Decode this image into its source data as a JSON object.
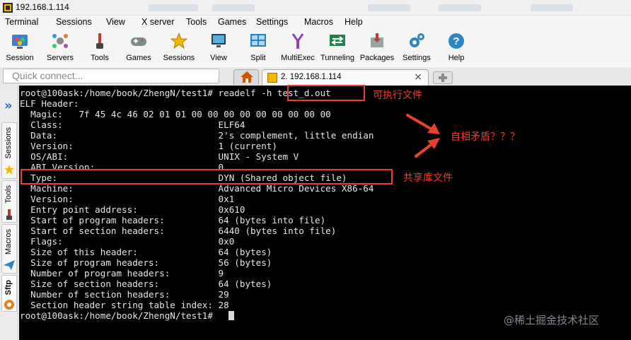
{
  "window": {
    "title": "192.168.1.114"
  },
  "menu": [
    "Terminal",
    "Sessions",
    "View",
    "X server",
    "Tools",
    "Games",
    "Settings",
    "Macros",
    "Help"
  ],
  "toolbar": [
    {
      "label": "Session",
      "icon": "session-icon"
    },
    {
      "label": "Servers",
      "icon": "servers-icon"
    },
    {
      "label": "Tools",
      "icon": "tools-icon"
    },
    {
      "label": "Games",
      "icon": "games-icon"
    },
    {
      "label": "Sessions",
      "icon": "star-icon"
    },
    {
      "label": "View",
      "icon": "view-icon"
    },
    {
      "label": "Split",
      "icon": "split-icon"
    },
    {
      "label": "MultiExec",
      "icon": "multiexec-icon"
    },
    {
      "label": "Tunneling",
      "icon": "tunneling-icon"
    },
    {
      "label": "Packages",
      "icon": "packages-icon"
    },
    {
      "label": "Settings",
      "icon": "gear-icon"
    },
    {
      "label": "Help",
      "icon": "help-icon"
    }
  ],
  "quick_connect": {
    "placeholder": "Quick connect..."
  },
  "tabs": {
    "session_label": "2. 192.168.1.114",
    "close_glyph": "×"
  },
  "side_tabs": [
    "Sessions",
    "Tools",
    "Macros",
    "Sftp"
  ],
  "terminal": {
    "lines": [
      "root@100ask:/home/book/ZhengN/test1# readelf -h test_d.out",
      "ELF Header:",
      "  Magic:   7f 45 4c 46 02 01 01 00 00 00 00 00 00 00 00 00",
      "  Class:                             ELF64",
      "  Data:                              2's complement, little endian",
      "  Version:                           1 (current)",
      "  OS/ABI:                            UNIX - System V",
      "  ABI Version:                       0",
      "  Type:                              DYN (Shared object file)",
      "  Machine:                           Advanced Micro Devices X86-64",
      "  Version:                           0x1",
      "  Entry point address:               0x610",
      "  Start of program headers:          64 (bytes into file)",
      "  Start of section headers:          6440 (bytes into file)",
      "  Flags:                             0x0",
      "  Size of this header:               64 (bytes)",
      "  Size of program headers:           56 (bytes)",
      "  Number of program headers:         9",
      "  Size of section headers:           64 (bytes)",
      "  Number of section headers:         29",
      "  Section header string table index: 28",
      "root@100ask:/home/book/ZhengN/test1# "
    ]
  },
  "annotations": {
    "executable": "可执行文件",
    "contradiction": "自相矛盾？？？",
    "shared_lib": "共享库文件"
  },
  "watermark": "@稀土掘金技术社区",
  "colors": {
    "annotation": "#e8402a",
    "terminal_bg": "#000000",
    "terminal_fg": "#e6e6e6"
  }
}
